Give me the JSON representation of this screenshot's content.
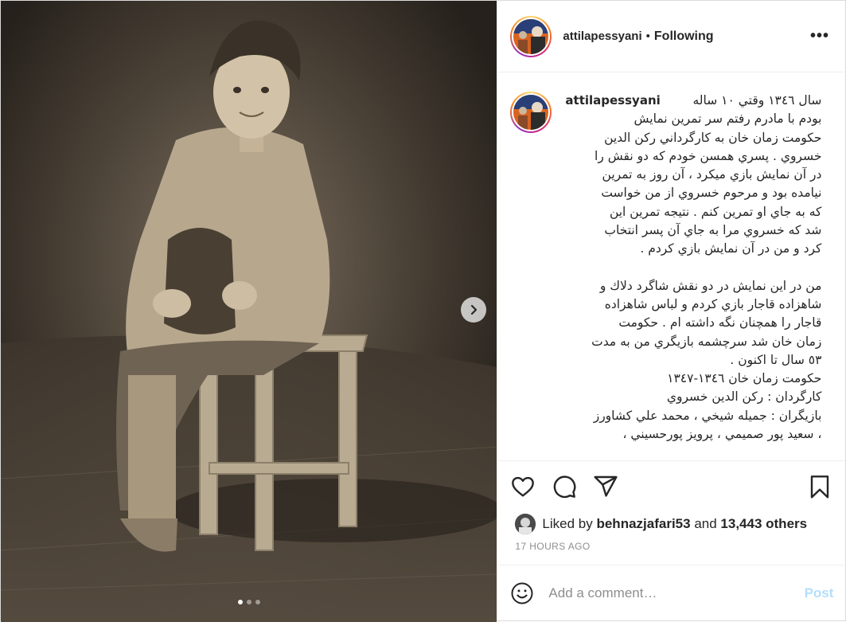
{
  "post": {
    "username": "attilapessyani",
    "separator": "•",
    "follow_state": "Following",
    "more_label": "•••"
  },
  "carousel": {
    "slide_count": 3,
    "active_index": 0
  },
  "caption": {
    "username": "attilapessyani",
    "lines": [
      "سال ۱۳٤٦ وقتي ۱۰ ساله",
      "بودم با مادرم رفتم سر تمرين نمايش",
      "حكومت زمان خان به كارگرداني ركن الدين",
      "خسروي . پسري همسن خودم كه دو نقش را",
      "در آن نمايش بازي ميكرد ، آن روز به تمرين",
      "نيامده بود و مرحوم خسروي از من خواست",
      "كه به جاي او تمرين كنم . نتيجه تمرين اين",
      "شد كه خسروي مرا به جاي آن پسر انتخاب",
      "كرد و من در آن نمايش بازي كردم ."
    ],
    "lines2": [
      "من در اين نمايش در دو نقش شاگرد دلاك و",
      "شاهزاده قاجار بازي كردم و لباس شاهزاده",
      "قاجار را همچنان نگه داشته ام . حكومت",
      "زمان خان شد سرچشمه بازيگري من به مدت",
      "٥٣ سال تا اكنون .",
      "حكومت زمان خان ۱۳٤٦-۱۳٤۷",
      "كارگردان : ركن الدين خسروي",
      "بازيگران : جميله شيخي ، محمد علي كشاورز",
      "، سعيد پور صميمي ، پرويز پورحسيني ،"
    ]
  },
  "likes": {
    "prefix": "Liked by",
    "liker": "behnazjafari53",
    "conjunction": "and",
    "others": "13,443 others"
  },
  "timestamp": "17 HOURS AGO",
  "comment_box": {
    "placeholder": "Add a comment…",
    "post_label": "Post"
  },
  "icons": {
    "like": "heart-icon",
    "comment": "comment-bubble-icon",
    "share": "paper-plane-icon",
    "save": "bookmark-icon",
    "emoji": "emoji-smile-icon",
    "next": "chevron-right-icon"
  },
  "colors": {
    "post_button": "#b2dffc",
    "muted": "#8e8e8e",
    "text": "#262626"
  }
}
